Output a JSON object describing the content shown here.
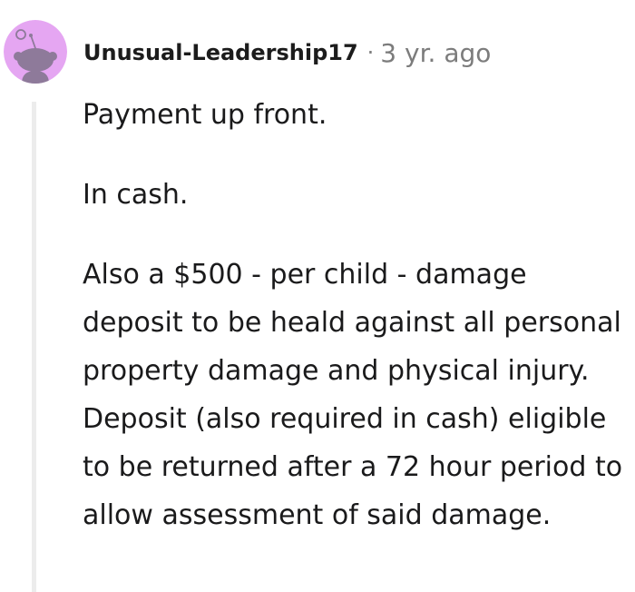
{
  "comment": {
    "username": "Unusual-Leadership17",
    "separator": "·",
    "timestamp": "3 yr. ago",
    "avatar_icon": "reddit-snoo-avatar-icon",
    "avatar_bg_color": "#e5a6f2",
    "paragraphs": [
      "Payment up front.",
      "In cash.",
      "Also a $500 - per child - damage deposit to be heald against all personal property damage and physical injury. Deposit (also required in cash) eligible to be returned after a 72 hour period to allow assessment of said damage."
    ]
  }
}
